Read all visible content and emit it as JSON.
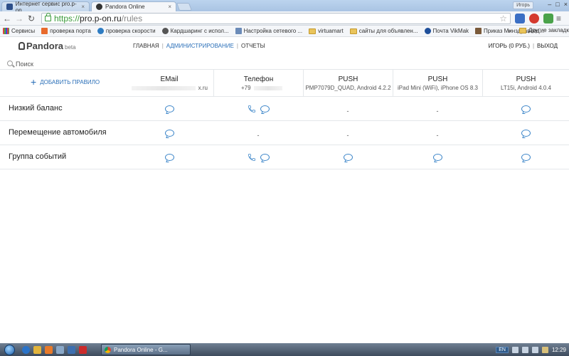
{
  "browser": {
    "tabs": [
      {
        "title": "Интернет сервис pro.p-on",
        "active": false
      },
      {
        "title": "Pandora Online",
        "active": true
      }
    ],
    "user_chip": "Игорь",
    "url": {
      "scheme": "https://",
      "host": "pro.p-on.ru",
      "path": "/rules"
    },
    "bookmarks": [
      {
        "label": "Сервисы",
        "icon": "apps-icon"
      },
      {
        "label": "проверка порта",
        "icon": "bookmark-icon"
      },
      {
        "label": "проверка скорости",
        "icon": "speedtest-icon"
      },
      {
        "label": "Кардшаринг с испол...",
        "icon": "bookmark-icon"
      },
      {
        "label": "Настройка сетевого ...",
        "icon": "bookmark-icon"
      },
      {
        "label": "virtuamart",
        "icon": "folder-icon"
      },
      {
        "label": "сайты для объявлен...",
        "icon": "folder-icon"
      },
      {
        "label": "Почта VikMak",
        "icon": "bookmark-icon"
      },
      {
        "label": "Приказ Минздравсоц...",
        "icon": "bookmark-icon"
      }
    ],
    "bookmarks_more": "»",
    "bookmarks_other": "Другие закладки"
  },
  "site": {
    "logo": "Pandora",
    "logo_badge": "beta",
    "nav": [
      {
        "label": "ГЛАВНАЯ",
        "current": false
      },
      {
        "label": "АДМИНИСТРИРОВАНИЕ",
        "current": true
      },
      {
        "label": "ОТЧЕТЫ",
        "current": false
      }
    ],
    "user_label": "ИГОРЬ (0 РУБ.)",
    "logout_label": "ВЫХОД",
    "search_placeholder": "Поиск",
    "add_rule_label": "ДОБАВИТЬ ПРАВИЛО"
  },
  "columns": [
    {
      "title": "EMail",
      "subtitle": "x.ru"
    },
    {
      "title": "Телефон",
      "subtitle": "+79"
    },
    {
      "title": "PUSH",
      "subtitle": "PMP7079D_QUAD, Android 4.2.2"
    },
    {
      "title": "PUSH",
      "subtitle": "iPad Mini (WiFi), iPhone OS 8.3"
    },
    {
      "title": "PUSH",
      "subtitle": "LT15i, Android 4.0.4"
    }
  ],
  "rules": [
    {
      "name": "Низкий баланс",
      "cells": [
        [
          "message"
        ],
        [
          "phone",
          "message"
        ],
        [],
        [],
        [
          "message"
        ]
      ]
    },
    {
      "name": "Перемещение автомобиля",
      "cells": [
        [
          "message"
        ],
        [],
        [],
        [],
        [
          "message"
        ]
      ]
    },
    {
      "name": "Группа событий",
      "cells": [
        [
          "message"
        ],
        [
          "phone",
          "message"
        ],
        [
          "message"
        ],
        [
          "message"
        ],
        [
          "message"
        ]
      ]
    }
  ],
  "empty_cell_text": "-",
  "taskbar": {
    "window_title": "Pandora Online - G...",
    "language": "EN",
    "clock": "12:29"
  },
  "colors": {
    "accent": "#2a6fb8",
    "icon": "#3d86c9",
    "url_secure": "#3a9a3a"
  }
}
